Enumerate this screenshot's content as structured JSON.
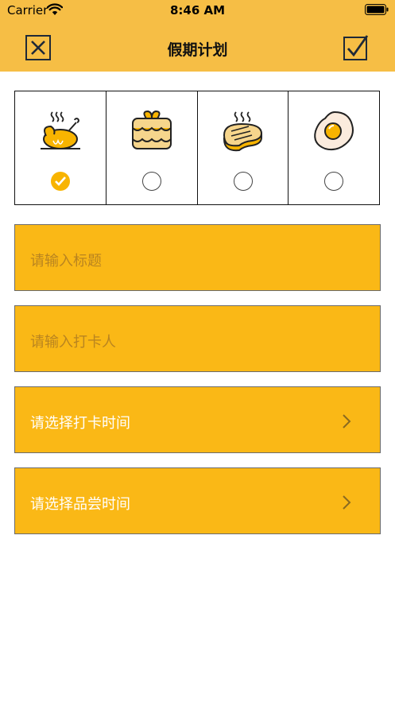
{
  "status_bar": {
    "carrier": "Carrier",
    "time": "8:46 AM"
  },
  "nav": {
    "title": "假期计划",
    "close_icon": "close-icon",
    "confirm_icon": "checkmark-icon"
  },
  "categories": [
    {
      "icon": "roast-chicken-icon",
      "selected": true
    },
    {
      "icon": "cake-icon",
      "selected": false
    },
    {
      "icon": "steak-icon",
      "selected": false
    },
    {
      "icon": "fried-egg-icon",
      "selected": false
    }
  ],
  "form": {
    "title_placeholder": "请输入标题",
    "checker_placeholder": "请输入打卡人",
    "checkin_time_label": "请选择打卡时间",
    "tasting_time_label": "请选择品尝时间"
  },
  "colors": {
    "header": "#F6BE45",
    "field": "#FAB816",
    "accent": "#F8B400"
  }
}
